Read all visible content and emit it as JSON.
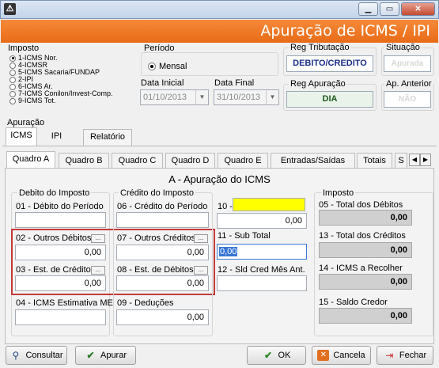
{
  "window": {
    "title": "",
    "app_icon": "red-notes-icon"
  },
  "banner": {
    "title": "Apuração de ICMS / IPI"
  },
  "imposto": {
    "label": "Imposto",
    "options": [
      "1-ICMS Nor.",
      "4-ICMSR",
      "5-ICMS Sacaria/FUNDAP",
      "2-IPI",
      "6-ICMS Ar.",
      "7-ICMS Conilon/Invest-Comp.",
      "9-ICMS Tot."
    ],
    "selected": 0
  },
  "periodo": {
    "label": "Período",
    "mensal_label": "Mensal",
    "data_inicial_label": "Data Inicial",
    "data_inicial": "01/10/2013",
    "data_final_label": "Data Final",
    "data_final": "31/10/2013"
  },
  "reg_tributacao": {
    "label": "Reg Tributação",
    "value": "DEBITO/CREDITO"
  },
  "situacao": {
    "label": "Situação",
    "value": "Apurada"
  },
  "reg_apuracao": {
    "label": "Reg Apuração",
    "value": "DIA"
  },
  "ap_anterior": {
    "label": "Ap. Anterior",
    "value": "NÃO"
  },
  "apuracao": {
    "label": "Apuração",
    "tabs": [
      "ICMS",
      "IPI",
      "Relatório"
    ]
  },
  "quadros": [
    "Quadro A",
    "Quadro B",
    "Quadro C",
    "Quadro D",
    "Quadro E",
    "Entradas/Saídas",
    "Totais",
    "S"
  ],
  "section_title": "A - Apuração do ICMS",
  "debito": {
    "label": "Debito do Imposto",
    "f01_label": "01 - Débito do Período",
    "f01": "",
    "f02_label": "02 - Outros Débitos",
    "f02": "0,00",
    "f03_label": "03 - Est. de Créditos",
    "f03": "0,00",
    "f04_label": "04 - ICMS Estimativa ME",
    "f04": ""
  },
  "credito": {
    "label": "Crédito do Imposto",
    "f06_label": "06 - Crédito do Período",
    "f06": "",
    "f07_label": "07 - Outros Créditos",
    "f07": "0,00",
    "f08_label": "08 - Est. de Débitos",
    "f08": "0,00",
    "f09_label": "09 - Deduções",
    "f09": "0,00"
  },
  "mid": {
    "f10_label": "10 -",
    "f10": "0,00",
    "f11_label": "11 - Sub Total",
    "f11": "0,00",
    "f12_label": "12 - Sld Cred Mês Ant.",
    "f12": ""
  },
  "imposto_totais": {
    "label": "Imposto",
    "f05_label": "05 - Total dos Débitos",
    "f05": "0,00",
    "f13_label": "13 - Total dos Créditos",
    "f13": "0,00",
    "f14_label": "14 - ICMS a Recolher",
    "f14": "0,00",
    "f15_label": "15 - Saldo Credor",
    "f15": "0,00"
  },
  "dots": "...",
  "buttons": {
    "consultar": "Consultar",
    "apurar": "Apurar",
    "ok": "OK",
    "cancela": "Cancela",
    "fechar": "Fechar"
  },
  "colors": {
    "banner": "#ee7420",
    "highlight_field": "#ffff00",
    "red_box": "#c43a3a"
  }
}
